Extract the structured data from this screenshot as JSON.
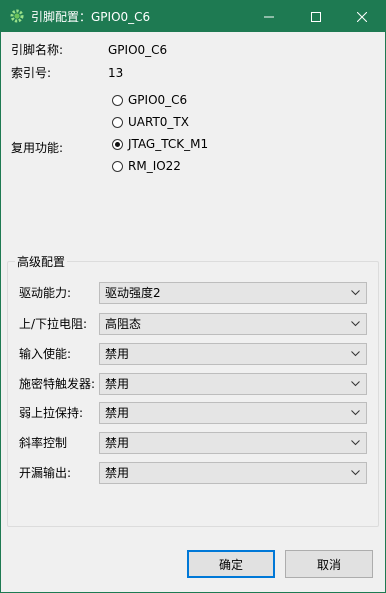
{
  "window": {
    "title": "引脚配置：GPIO0_C6"
  },
  "info": {
    "pin_name_label": "引脚名称:",
    "pin_name_value": "GPIO0_C6",
    "index_label": "索引号:",
    "index_value": "13",
    "mux_label": "复用功能:"
  },
  "mux_options": [
    {
      "label": "GPIO0_C6",
      "checked": false
    },
    {
      "label": "UART0_TX",
      "checked": false
    },
    {
      "label": "JTAG_TCK_M1",
      "checked": true
    },
    {
      "label": "RM_IO22",
      "checked": false
    }
  ],
  "advanced": {
    "title": "高级配置",
    "rows": [
      {
        "label": "驱动能力:",
        "value": "驱动强度2"
      },
      {
        "label": "上/下拉电阻:",
        "value": "高阻态"
      },
      {
        "label": "输入使能:",
        "value": "禁用"
      },
      {
        "label": "施密特触发器:",
        "value": "禁用"
      },
      {
        "label": "弱上拉保持:",
        "value": "禁用"
      },
      {
        "label": "斜率控制",
        "value": "禁用"
      },
      {
        "label": "开漏输出:",
        "value": "禁用"
      }
    ]
  },
  "buttons": {
    "ok": "确定",
    "cancel": "取消"
  },
  "colors": {
    "titlebar": "#1e7a52",
    "primary_border": "#0078d7"
  }
}
